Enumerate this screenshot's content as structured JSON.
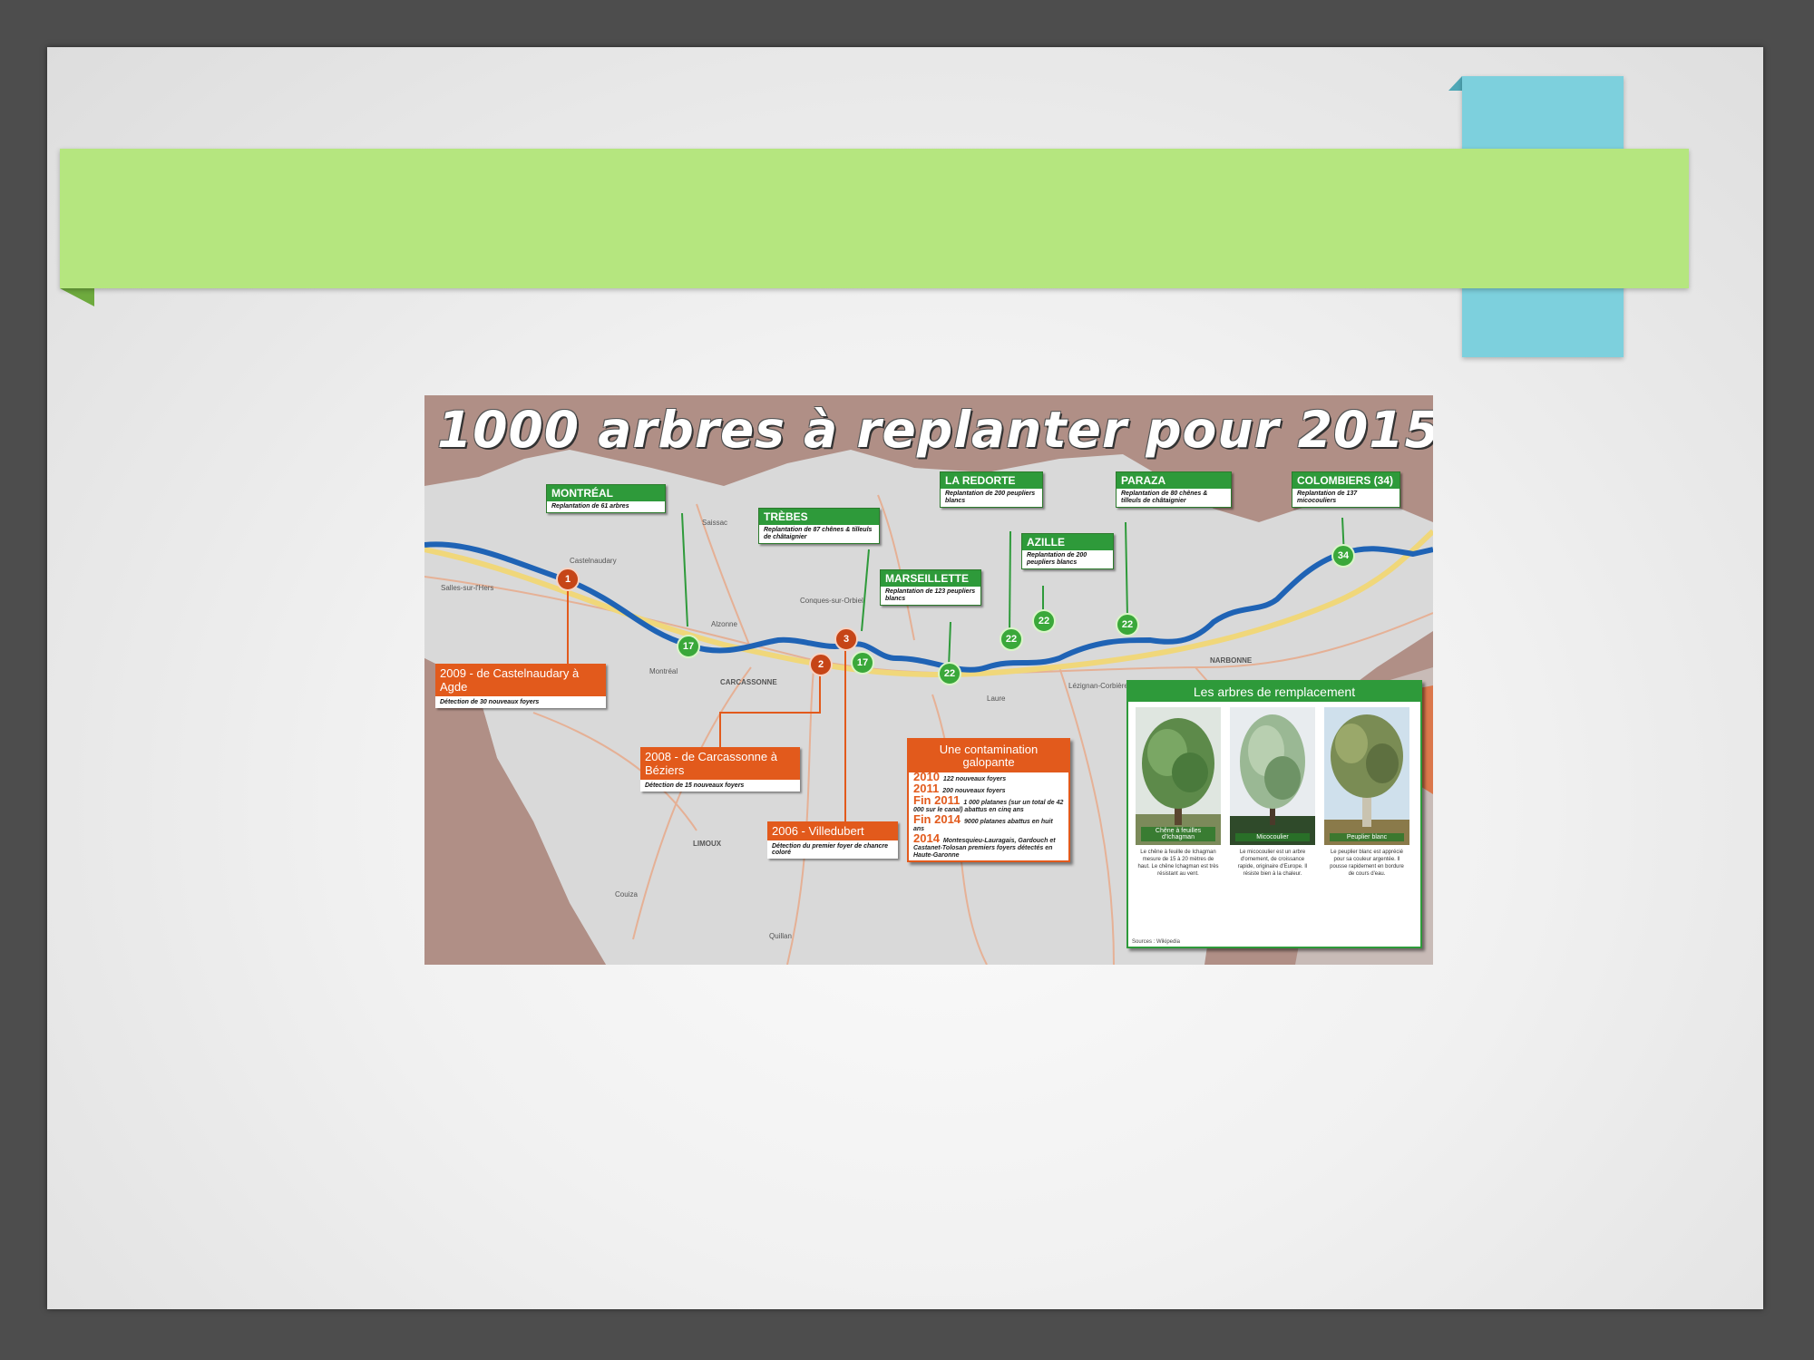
{
  "slide": {
    "title": ""
  },
  "figure": {
    "title": "1000 arbres à replanter pour 2015",
    "green_labels": [
      {
        "name": "MONTRÉAL",
        "text": "Replantation de 61 arbres"
      },
      {
        "name": "TRÈBES",
        "text": "Replantation de 87 chênes & tilleuls de châtaignier"
      },
      {
        "name": "MARSEILLETTE",
        "text": "Replantation de 123 peupliers blancs"
      },
      {
        "name": "LA REDORTE",
        "text": "Replantation de 200 peupliers blancs"
      },
      {
        "name": "AZILLE",
        "text": "Replantation de 200 peupliers blancs"
      },
      {
        "name": "PARAZA",
        "text": "Replantation de 80 chênes & tilleuls de châtaignier"
      },
      {
        "name": "COLOMBIERS (34)",
        "text": "Replantation de 137 micocouliers"
      }
    ],
    "orange_labels": [
      {
        "title": "2009 - de Castelnaudary à Agde",
        "text": "Détection de 30 nouveaux foyers"
      },
      {
        "title": "2008 - de Carcassonne à Béziers",
        "text": "Détection de 15 nouveaux foyers"
      },
      {
        "title": "2006 - Villedubert",
        "text": "Détection du premier foyer de chancre coloré"
      }
    ],
    "timeline": {
      "title": "Une contamination galopante",
      "rows": [
        {
          "year": "2010",
          "text": "122 nouveaux foyers"
        },
        {
          "year": "2011",
          "text": "200 nouveaux foyers"
        },
        {
          "year": "Fin 2011",
          "text": "1 000 platanes (sur un total de 42 000 sur le canal) abattus en cinq ans"
        },
        {
          "year": "Fin 2014",
          "text": "9000 platanes abattus en huit ans"
        },
        {
          "year": "2014",
          "text": "Montesquieu-Lauragais, Gardouch et Castanet-Tolosan premiers foyers détectés en Haute-Garonne"
        }
      ]
    },
    "trees": {
      "title": "Les arbres de remplacement",
      "items": [
        {
          "caption": "Chêne à feuilles d'Ichagman",
          "text": "Le chêne à feuille de Ichagman mesure de 15 à 20 mètres de haut. Le chêne Ichagman est très résistant au vent."
        },
        {
          "caption": "Micocoulier",
          "text": "Le micocoulier est un arbre d'ornement, de croissance rapide, originaire d'Europe. Il résiste bien à la chaleur."
        },
        {
          "caption": "Peuplier blanc",
          "text": "Le peuplier blanc est apprécié pour sa couleur argentée. Il pousse rapidement en bordure de cours d'eau."
        }
      ],
      "source": "Sources : Wikipedia"
    },
    "pins": {
      "orange": [
        "1",
        "2",
        "3"
      ],
      "green": [
        "17",
        "17",
        "22",
        "22",
        "22",
        "22",
        "34"
      ]
    },
    "towns": [
      "Castelnaudary",
      "Saissac",
      "Alzonne",
      "Conques-sur-Orbiel",
      "Montréal",
      "CARCASSONNE",
      "Laure",
      "Lézignan-Corbières",
      "NARBONNE",
      "LIMOUX",
      "Quillan",
      "Couiza",
      "Salles-sur-l'Hers"
    ]
  }
}
